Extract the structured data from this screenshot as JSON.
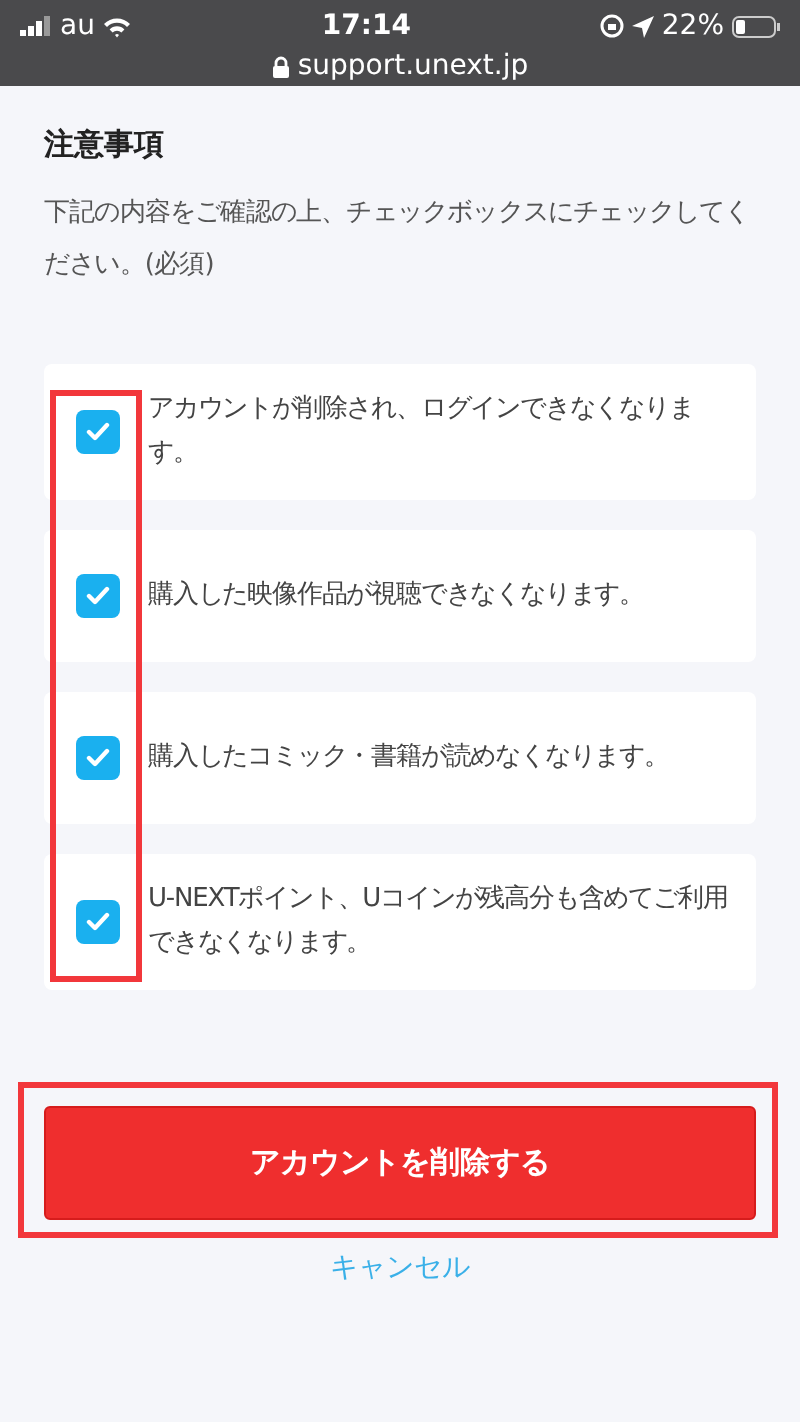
{
  "status_bar": {
    "carrier": "au",
    "time": "17:14",
    "battery": "22%",
    "url": "support.unext.jp"
  },
  "heading": "注意事項",
  "description": "下記の内容をご確認の上、チェックボックスにチェックしてください。(必須)",
  "checklist": {
    "highlighted": true,
    "items": [
      {
        "label": "アカウントが削除され、ログインできなくなります。",
        "checked": true
      },
      {
        "label": "購入した映像作品が視聴できなくなります。",
        "checked": true
      },
      {
        "label": "購入したコミック・書籍が読めなくなります。",
        "checked": true
      },
      {
        "label": "U-NEXTポイント、Uコインが残高分も含めてご利用できなくなります。",
        "checked": true
      }
    ]
  },
  "delete_button": {
    "label": "アカウントを削除する",
    "highlighted": true
  },
  "cancel_link": "キャンセル"
}
